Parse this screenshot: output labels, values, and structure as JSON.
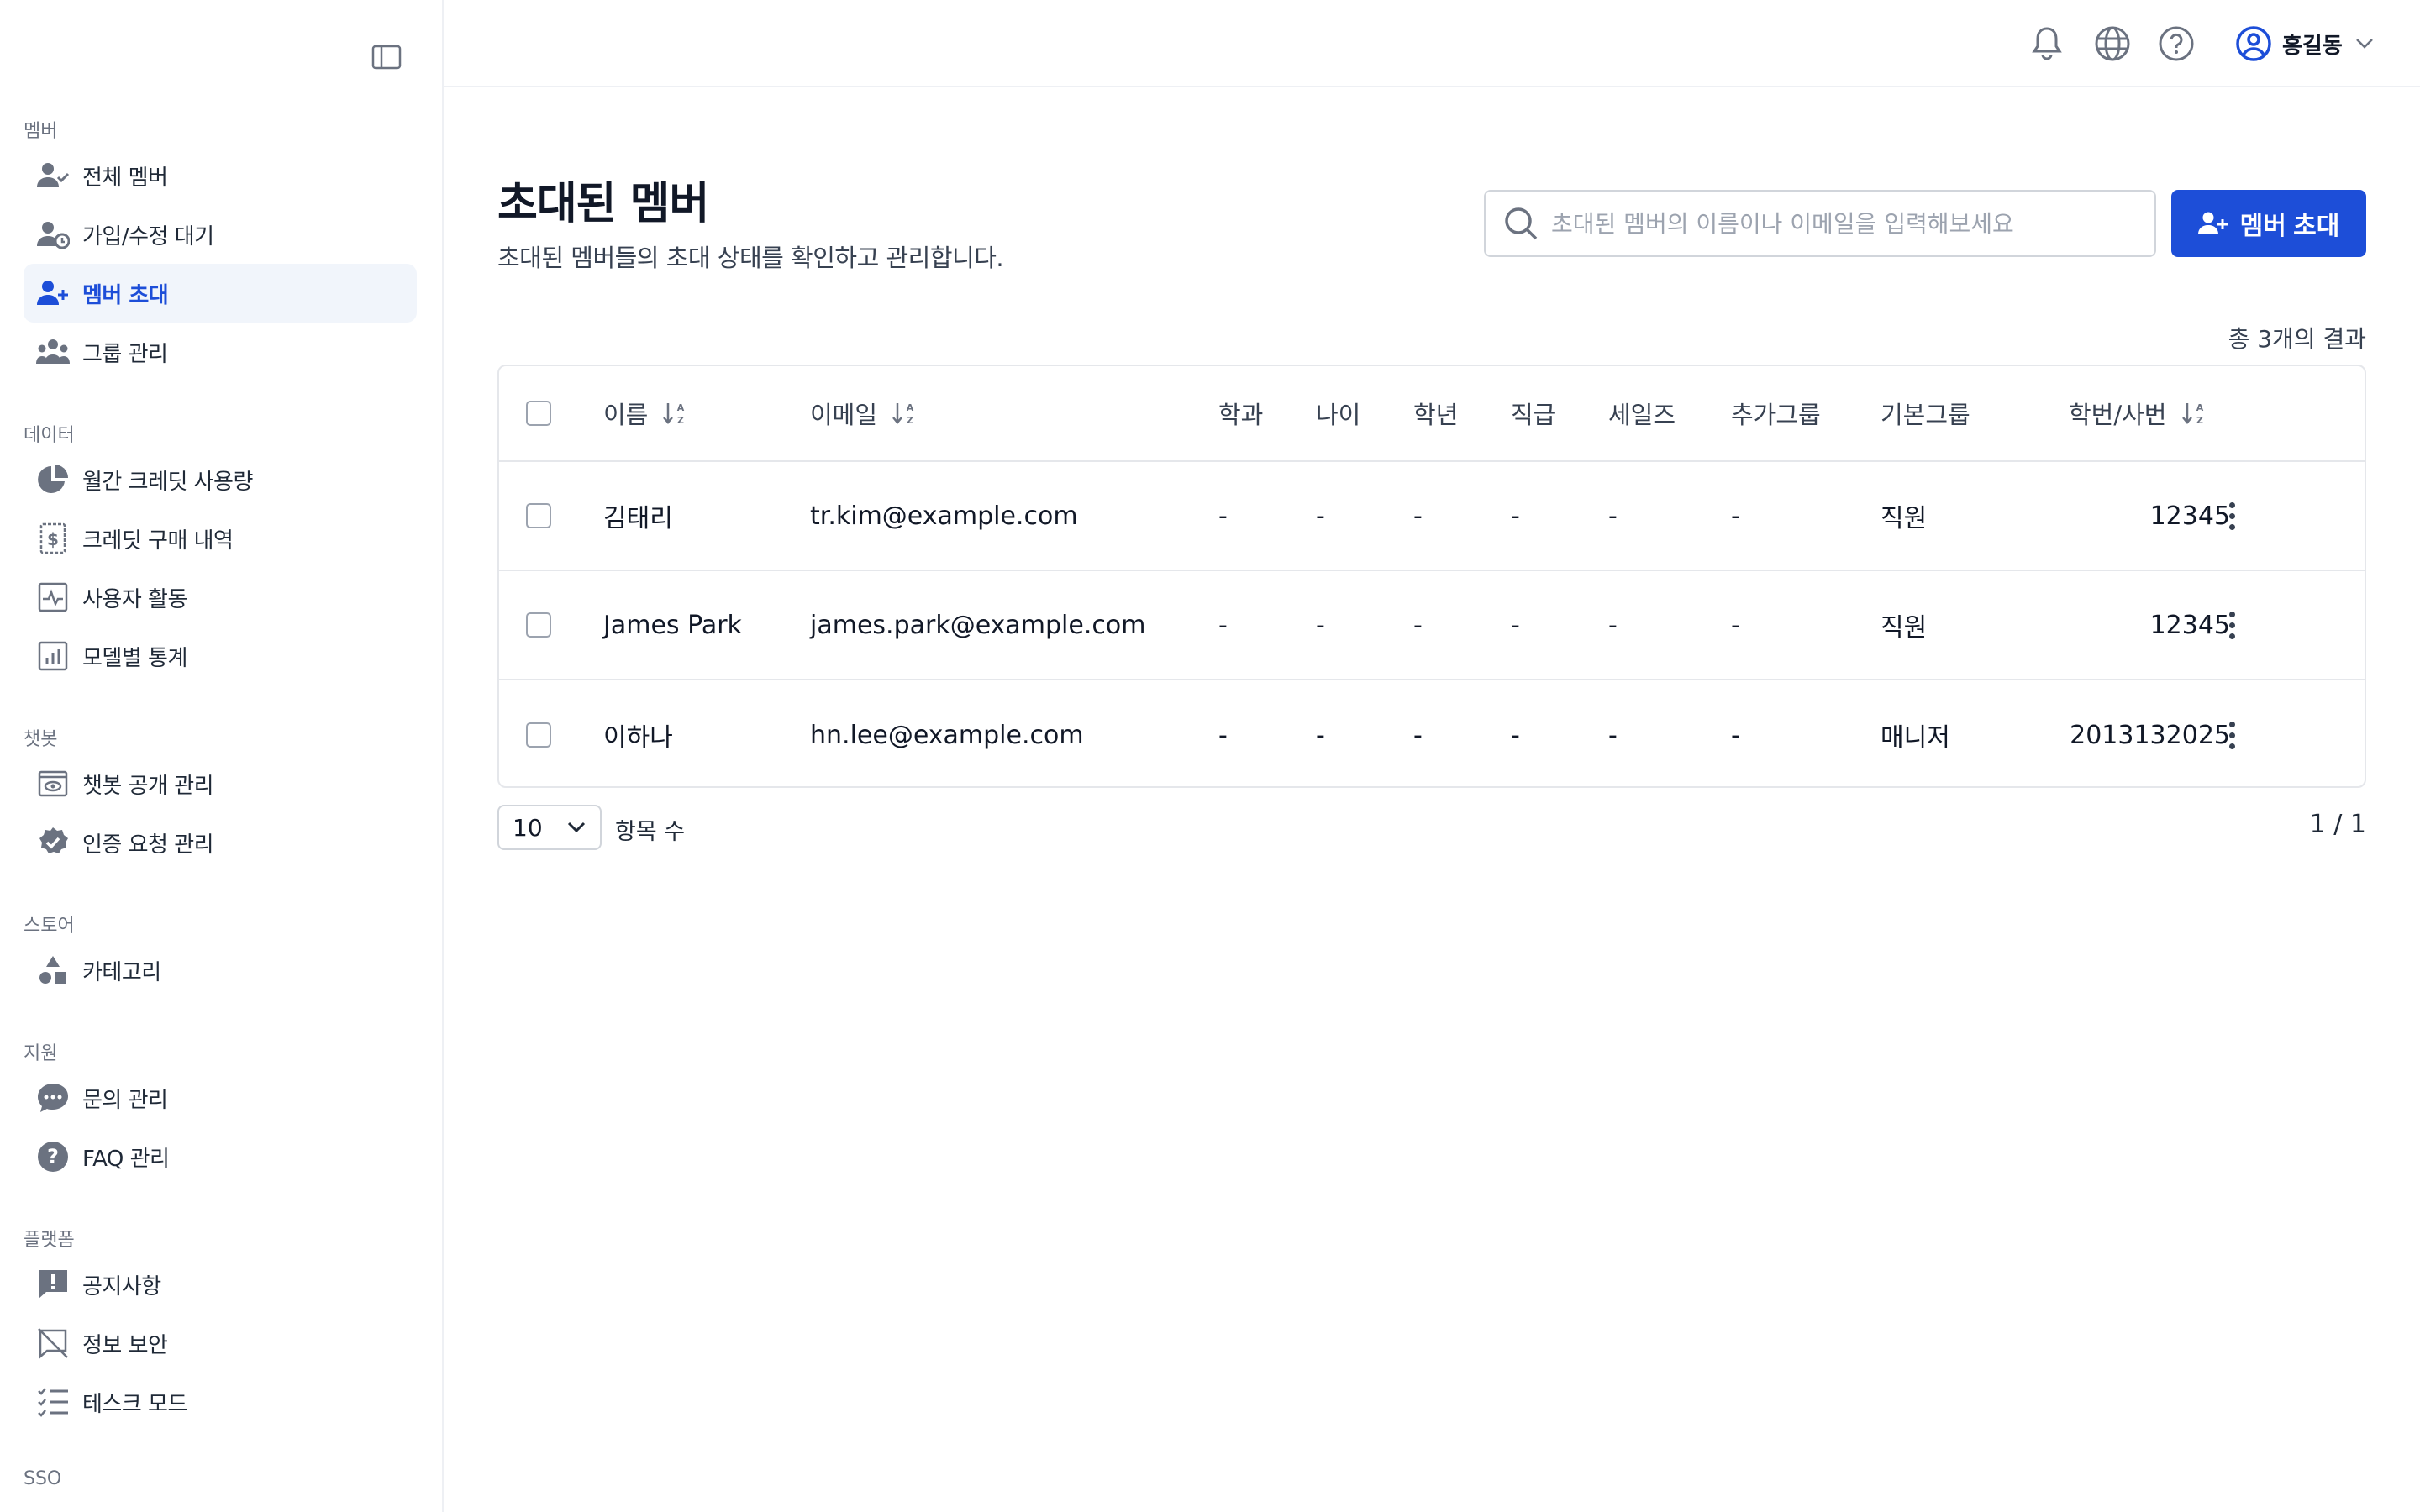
{
  "sidebar": {
    "sections": [
      {
        "label": "멤버",
        "items": [
          {
            "label": "전체 멤버",
            "icon": "users-check-icon"
          },
          {
            "label": "가입/수정 대기",
            "icon": "user-clock-icon"
          },
          {
            "label": "멤버 초대",
            "icon": "user-plus-icon",
            "active": true
          },
          {
            "label": "그룹 관리",
            "icon": "group-icon"
          }
        ]
      },
      {
        "label": "데이터",
        "items": [
          {
            "label": "월간 크레딧 사용량",
            "icon": "pie-chart-icon"
          },
          {
            "label": "크레딧 구매 내역",
            "icon": "receipt-dollar-icon"
          },
          {
            "label": "사용자 활동",
            "icon": "activity-icon"
          },
          {
            "label": "모델별 통계",
            "icon": "bar-chart-icon"
          }
        ]
      },
      {
        "label": "챗봇",
        "items": [
          {
            "label": "챗봇 공개 관리",
            "icon": "eye-window-icon"
          },
          {
            "label": "인증 요청 관리",
            "icon": "verified-badge-icon"
          }
        ]
      },
      {
        "label": "스토어",
        "items": [
          {
            "label": "카테고리",
            "icon": "shapes-icon"
          }
        ]
      },
      {
        "label": "지원",
        "items": [
          {
            "label": "문의 관리",
            "icon": "chat-bubble-icon"
          },
          {
            "label": "FAQ 관리",
            "icon": "question-circle-icon"
          }
        ]
      },
      {
        "label": "플랫폼",
        "items": [
          {
            "label": "공지사항",
            "icon": "announcement-icon"
          },
          {
            "label": "정보 보안",
            "icon": "security-off-icon"
          },
          {
            "label": "테스크 모드",
            "icon": "checklist-icon"
          }
        ]
      },
      {
        "label": "SSO",
        "items": []
      }
    ]
  },
  "topbar": {
    "user_name": "홍길동"
  },
  "main": {
    "title": "초대된 멤버",
    "subtitle": "초대된 멤버들의 초대 상태를 확인하고 관리합니다.",
    "search_placeholder": "초대된 멤버의 이름이나 이메일을 입력해보세요",
    "invite_button": "멤버 초대",
    "result_count": "총 3개의 결과"
  },
  "table": {
    "columns": [
      "이름",
      "이메일",
      "학과",
      "나이",
      "학년",
      "직급",
      "세일즈",
      "추가그룹",
      "기본그룹",
      "학번/사번"
    ],
    "rows": [
      {
        "name": "김태리",
        "email": "tr.kim@example.com",
        "dept": "-",
        "age": "-",
        "grade": "-",
        "position": "-",
        "sales": "-",
        "extra_group": "-",
        "base_group": "직원",
        "id_number": "12345"
      },
      {
        "name": "James Park",
        "email": "james.park@example.com",
        "dept": "-",
        "age": "-",
        "grade": "-",
        "position": "-",
        "sales": "-",
        "extra_group": "-",
        "base_group": "직원",
        "id_number": "12345"
      },
      {
        "name": "이하나",
        "email": "hn.lee@example.com",
        "dept": "-",
        "age": "-",
        "grade": "-",
        "position": "-",
        "sales": "-",
        "extra_group": "-",
        "base_group": "매니저",
        "id_number": "2013132025"
      }
    ]
  },
  "footer": {
    "page_size": "10",
    "page_size_label": "항목 수",
    "pagination": "1 / 1"
  },
  "colors": {
    "accent": "#1d4ed8",
    "active_bg": "#f1f5fb",
    "icon_gray": "#6b7280"
  }
}
